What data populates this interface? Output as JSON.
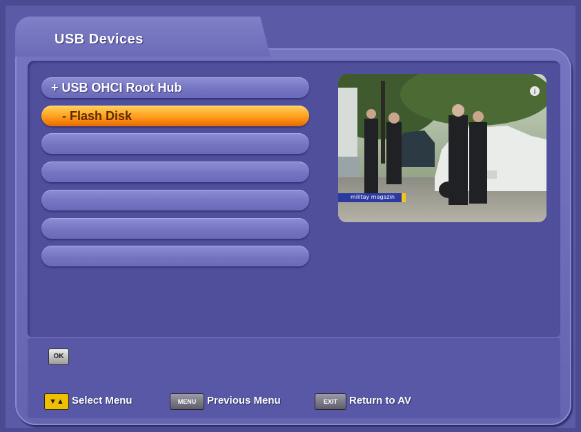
{
  "window": {
    "title": "USB Devices"
  },
  "device_list": {
    "items": [
      {
        "label": "+ USB OHCI Root Hub",
        "selected": false,
        "indent": 0
      },
      {
        "label": "- Flash Disk",
        "selected": true,
        "indent": 1
      },
      {
        "label": "",
        "selected": false,
        "indent": 0
      },
      {
        "label": "",
        "selected": false,
        "indent": 0
      },
      {
        "label": "",
        "selected": false,
        "indent": 0
      },
      {
        "label": "",
        "selected": false,
        "indent": 0
      },
      {
        "label": "",
        "selected": false,
        "indent": 0
      }
    ]
  },
  "preview": {
    "channel_caption": "militay magazin",
    "info_icon": "info-icon"
  },
  "footer": {
    "ok_key": "OK",
    "hints": [
      {
        "key": "▼▲",
        "label": "Select Menu",
        "key_color": "#f0c000"
      },
      {
        "key": "MENU",
        "label": "Previous Menu",
        "key_color": "#7a7a86"
      },
      {
        "key": "EXIT",
        "label": "Return to AV",
        "key_color": "#7a7a86"
      }
    ]
  },
  "colors": {
    "background": "#4b4b93",
    "selected_item": "#ff9c1c",
    "item": "#7a7ac6"
  }
}
